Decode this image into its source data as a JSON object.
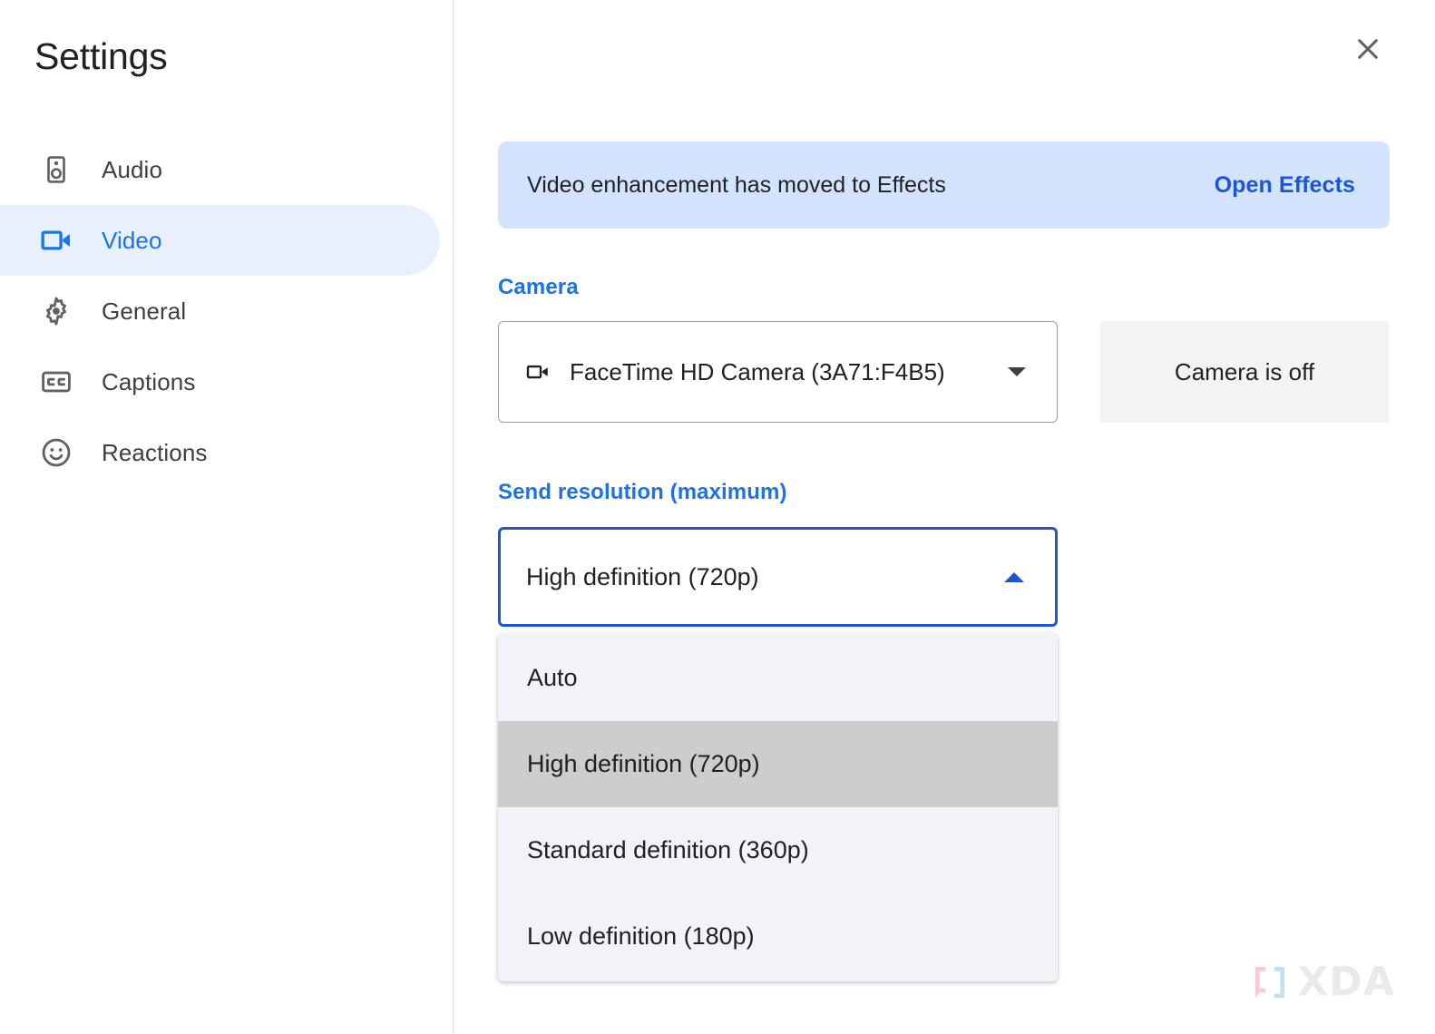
{
  "window": {
    "title": "Settings",
    "close_icon": "close-icon"
  },
  "sidebar": {
    "items": [
      {
        "label": "Audio",
        "icon": "speaker-icon",
        "active": false
      },
      {
        "label": "Video",
        "icon": "videocam-icon",
        "active": true
      },
      {
        "label": "General",
        "icon": "gear-icon",
        "active": false
      },
      {
        "label": "Captions",
        "icon": "closed-caption-icon",
        "active": false
      },
      {
        "label": "Reactions",
        "icon": "smiley-icon",
        "active": false
      }
    ]
  },
  "main": {
    "banner": {
      "message": "Video enhancement has moved to Effects",
      "action_label": "Open Effects"
    },
    "camera": {
      "section_label": "Camera",
      "selected_device": "FaceTime HD Camera (3A71:F4B5)",
      "device_icon": "videocam-icon",
      "caret_icon": "chevron-down-icon",
      "preview_status": "Camera is off"
    },
    "send_resolution": {
      "section_label": "Send resolution (maximum)",
      "selected_value": "High definition (720p)",
      "caret_icon": "chevron-up-icon",
      "expanded": true,
      "options": [
        {
          "label": "Auto",
          "selected": false
        },
        {
          "label": "High definition (720p)",
          "selected": true
        },
        {
          "label": "Standard definition (360p)",
          "selected": false
        },
        {
          "label": "Low definition (180p)",
          "selected": false
        }
      ]
    }
  },
  "watermark": {
    "text": "XDA"
  },
  "colors": {
    "accent_blue": "#1a73e8",
    "link_blue": "#1a56d6",
    "banner_bg": "#d3e2fd",
    "active_nav_bg": "#e8f0fe",
    "menu_bg": "#f1f3f9",
    "menu_selected_bg": "#cdcdcd",
    "preview_bg": "#f1f3f4",
    "text_primary": "#202124",
    "text_secondary": "#3c4043",
    "icon_gray": "#5f6368",
    "border_gray": "#9aa0a6"
  }
}
